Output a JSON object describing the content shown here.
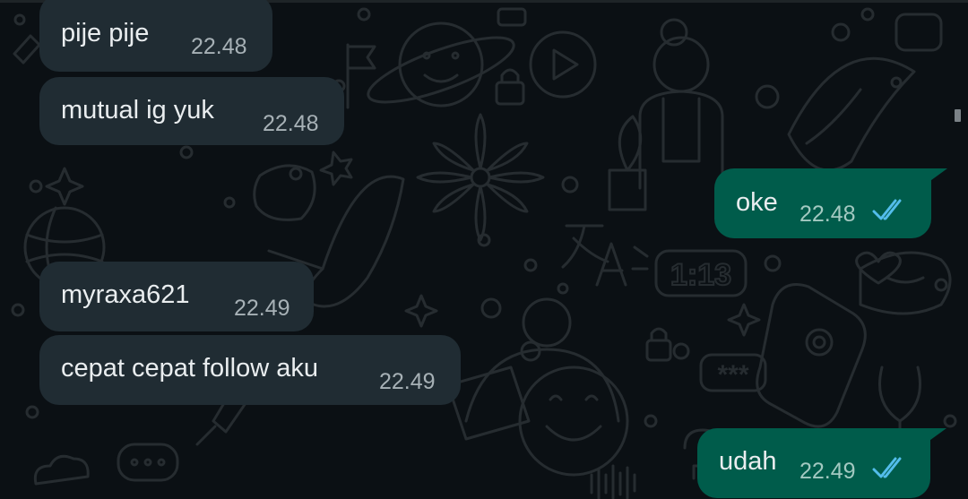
{
  "chat": {
    "messages": [
      {
        "direction": "incoming",
        "text": "pije pije",
        "time": "22.48"
      },
      {
        "direction": "incoming",
        "text": "mutual ig yuk",
        "time": "22.48"
      },
      {
        "direction": "outgoing",
        "text": "oke",
        "time": "22.48",
        "read_receipt": "double-check-blue"
      },
      {
        "direction": "incoming",
        "text": "myraxa621",
        "time": "22.49"
      },
      {
        "direction": "incoming",
        "text": "cepat cepat follow aku",
        "time": "22.49"
      },
      {
        "direction": "outgoing",
        "text": "udah",
        "time": "22.49",
        "read_receipt": "double-check-blue"
      }
    ]
  },
  "wallpaper_badges": {
    "clock_badge": "1:13",
    "password_badge": "***"
  },
  "colors": {
    "background": "#0b1014",
    "incoming_bubble": "#202c33",
    "outgoing_bubble": "#005c4b",
    "message_text": "#e9edef",
    "read_tick": "#53bdeb",
    "doodle": "#262c30"
  }
}
